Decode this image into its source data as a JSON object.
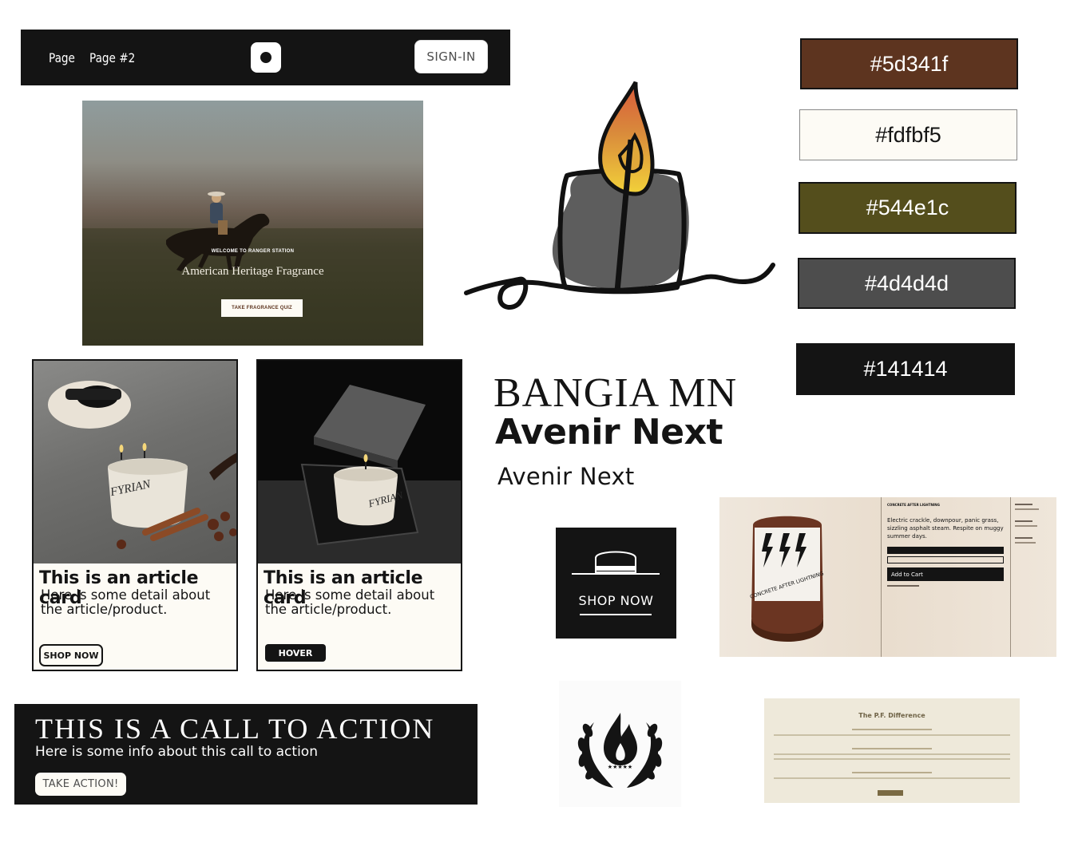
{
  "nav": {
    "links": [
      "Page",
      "Page #2"
    ],
    "signin_label": "SIGN-IN"
  },
  "hero": {
    "eyebrow": "WELCOME TO RANGER STATION",
    "title": "American Heritage Fragrance",
    "cta_label": "TAKE FRAGRANCE QUIZ"
  },
  "palette": [
    {
      "hex": "#5d341f",
      "text_color": "#ffffff"
    },
    {
      "hex": "#fdfbf5",
      "text_color": "#141414"
    },
    {
      "hex": "#544e1c",
      "text_color": "#ffffff"
    },
    {
      "hex": "#4d4d4d",
      "text_color": "#ffffff"
    },
    {
      "hex": "#141414",
      "text_color": "#ffffff"
    }
  ],
  "cards": [
    {
      "title": "This is an article card",
      "text": "Here is some detail about the article/product.",
      "button": "SHOP NOW",
      "brand_mark": "FYRIAN"
    },
    {
      "title": "This is an article card",
      "text": "Here is some detail about the article/product.",
      "button": "HOVER",
      "brand_mark": "FYRIAN"
    }
  ],
  "typography": {
    "serif_sample": "BANGIA MN",
    "bold_sample": "Avenir Next",
    "regular_sample": "Avenir Next"
  },
  "shop_block": {
    "label": "SHOP NOW"
  },
  "product": {
    "name": "CONCRETE AFTER LIGHTNING",
    "description": "Electric crackle, downpour, panic grass, sizzling asphalt steam. Respite on muggy summer days.",
    "add_to_cart": "Add to Cart",
    "label_text": "CONCRETE AFTER LIGHTNING"
  },
  "cta": {
    "title": "THIS IS A CALL TO ACTION",
    "text": "Here is some info about this call to action",
    "button": "TAKE ACTION!"
  },
  "badge": {
    "stars": "★★★★★"
  },
  "pf": {
    "title": "The P.F. Difference"
  },
  "colors": {
    "brown": "#5d341f",
    "cream": "#fdfbf5",
    "olive": "#544e1c",
    "gray": "#4d4d4d",
    "black": "#141414"
  }
}
